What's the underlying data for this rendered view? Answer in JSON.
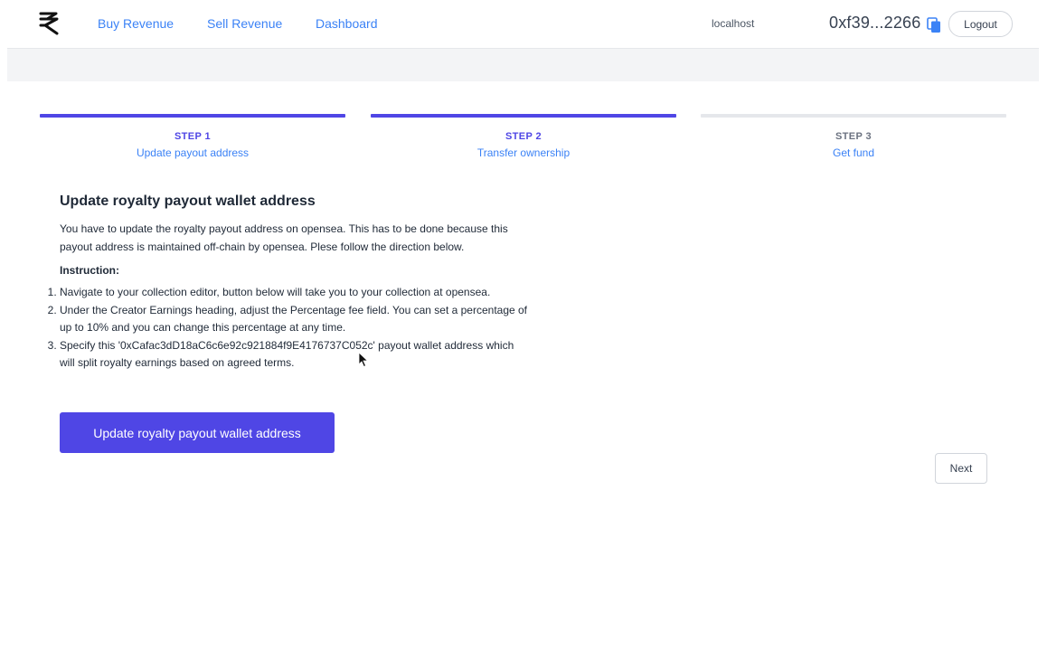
{
  "header": {
    "nav": [
      {
        "label": "Buy Revenue"
      },
      {
        "label": "Sell Revenue"
      },
      {
        "label": "Dashboard"
      }
    ],
    "host": "localhost",
    "wallet_address": "0xf39...2266",
    "logout_label": "Logout"
  },
  "steps": [
    {
      "number": "STEP 1",
      "title": "Update payout address",
      "status": "complete",
      "bar_color": "#4f46e5",
      "num_color": "#4f46e5"
    },
    {
      "number": "STEP 2",
      "title": "Transfer ownership",
      "status": "current",
      "bar_color": "#4f46e5",
      "num_color": "#4f46e5"
    },
    {
      "number": "STEP 3",
      "title": "Get fund",
      "status": "upcoming",
      "bar_color": "#e5e7eb",
      "num_color": "#6b7280"
    }
  ],
  "content": {
    "heading": "Update royalty payout wallet address",
    "description": "You have to update the royalty payout address on opensea. This has to be done because this payout address is maintained off-chain by opensea. Plese follow the direction below.",
    "instruction_label": "Instruction:",
    "instructions": [
      "Navigate to your collection editor, button below will take you to your collection at opensea.",
      "Under the Creator Earnings heading, adjust the Percentage fee field. You can set a percentage of up to 10% and you can change this percentage at any time.",
      "Specify this '0xCafac3dD18aC6c6e92c921884f9E4176737C052c' payout wallet address which will split royalty earnings based on agreed terms."
    ],
    "primary_button_label": "Update royalty payout wallet address",
    "next_button_label": "Next"
  },
  "colors": {
    "accent": "#4f46e5",
    "link": "#3b82f6"
  },
  "icons": {
    "logo": "brand-logo-icon",
    "copy": "copy-icon"
  }
}
